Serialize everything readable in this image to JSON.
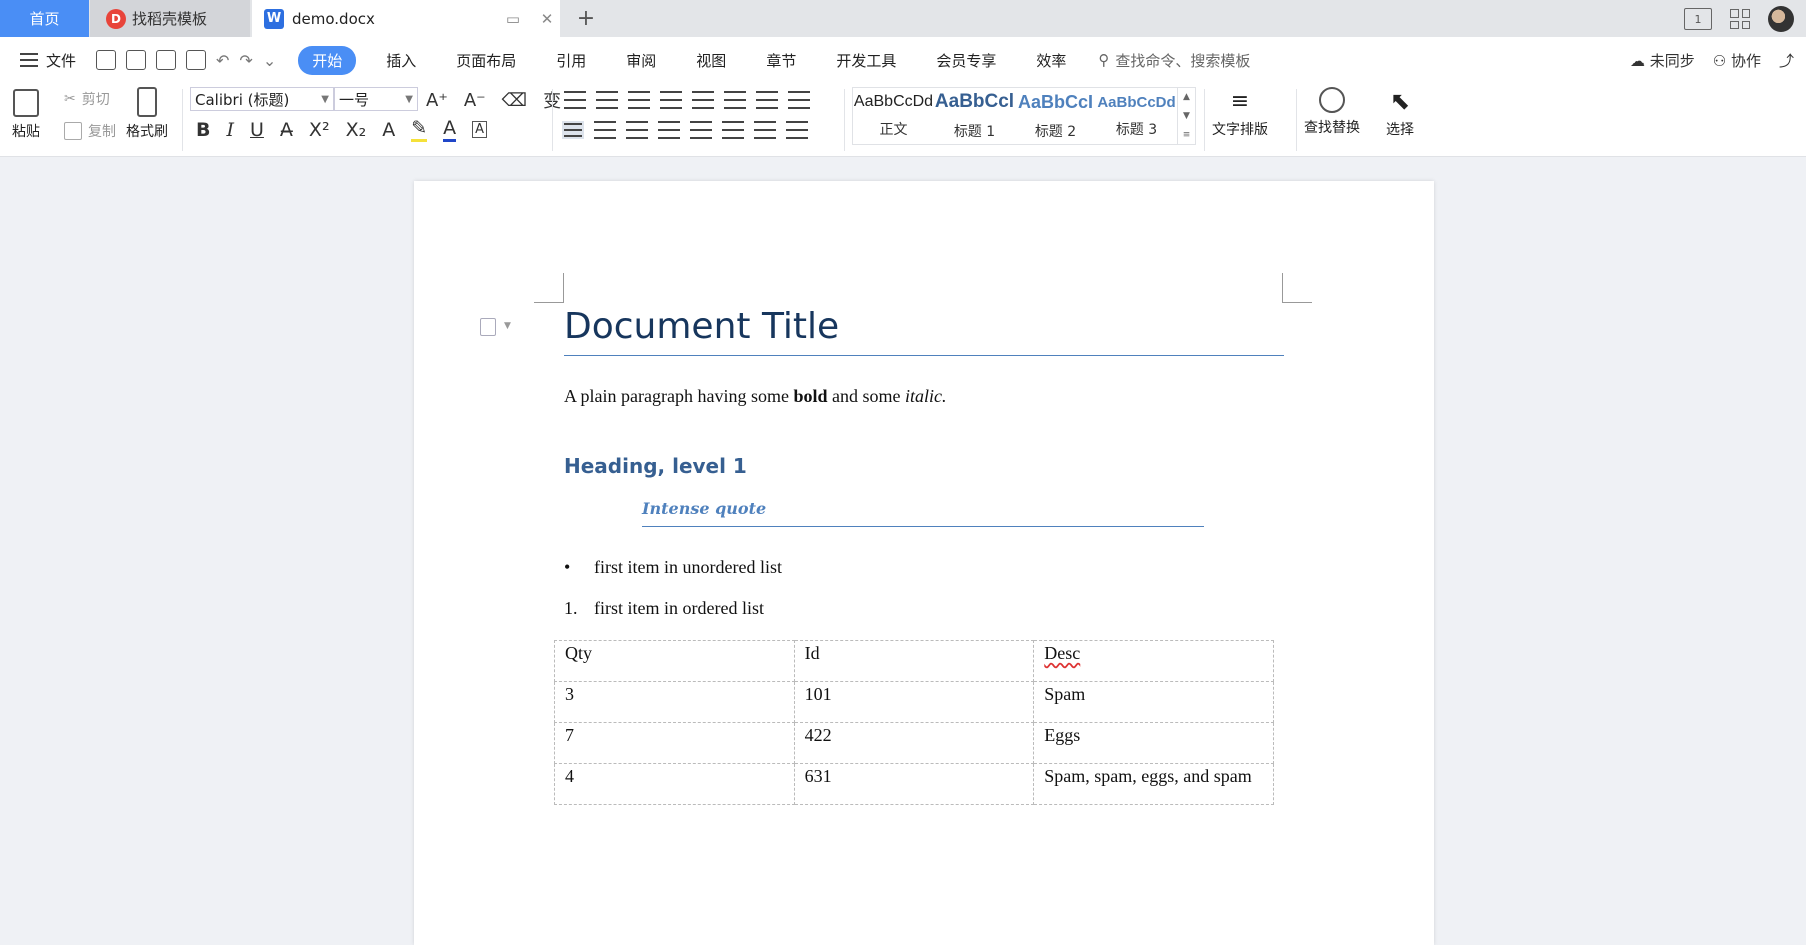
{
  "tabs": {
    "home": "首页",
    "template": "找稻壳模板",
    "doc": "demo.docx",
    "add": "+",
    "template_logo": "D",
    "doc_logo": "W"
  },
  "title_right": {
    "layout_icon_text": "1"
  },
  "menu": {
    "file": "文件",
    "items": [
      "开始",
      "插入",
      "页面布局",
      "引用",
      "审阅",
      "视图",
      "章节",
      "开发工具",
      "会员专享",
      "效率"
    ],
    "search_placeholder": "查找命令、搜索模板",
    "sync": "未同步",
    "collab": "协作"
  },
  "ribbon": {
    "paste": "粘贴",
    "cut": "剪切",
    "copy": "复制",
    "format_painter": "格式刷",
    "font_name": "Calibri (标题)",
    "font_size": "一号",
    "styles": [
      {
        "preview": "AaBbCcDd",
        "label": "正文",
        "color": "#222222",
        "bold": false
      },
      {
        "preview": "AaBbCcl",
        "label": "标题 1",
        "color": "#365f91",
        "bold": true
      },
      {
        "preview": "AaBbCcI",
        "label": "标题 2",
        "color": "#4f81bd",
        "bold": true
      },
      {
        "preview": "AaBbCcDd",
        "label": "标题 3",
        "color": "#4f81bd",
        "bold": true
      }
    ],
    "text_layout": "文字排版",
    "find_replace": "查找替换",
    "select": "选择"
  },
  "document": {
    "title": "Document Title",
    "paragraph": {
      "before_bold": "A plain paragraph having some ",
      "bold": "bold",
      "middle": " and some ",
      "italic": "italic."
    },
    "heading1": "Heading, level 1",
    "intense_quote": "Intense quote",
    "unordered_item": "first item in unordered list",
    "unordered_marker": "•",
    "ordered_item": "first item in ordered list",
    "ordered_marker": "1.",
    "table": {
      "headers": [
        "Qty",
        "Id",
        "Desc"
      ],
      "rows": [
        [
          "3",
          "101",
          "Spam"
        ],
        [
          "7",
          "422",
          "Eggs"
        ],
        [
          "4",
          "631",
          "Spam, spam, eggs, and spam"
        ]
      ]
    }
  }
}
